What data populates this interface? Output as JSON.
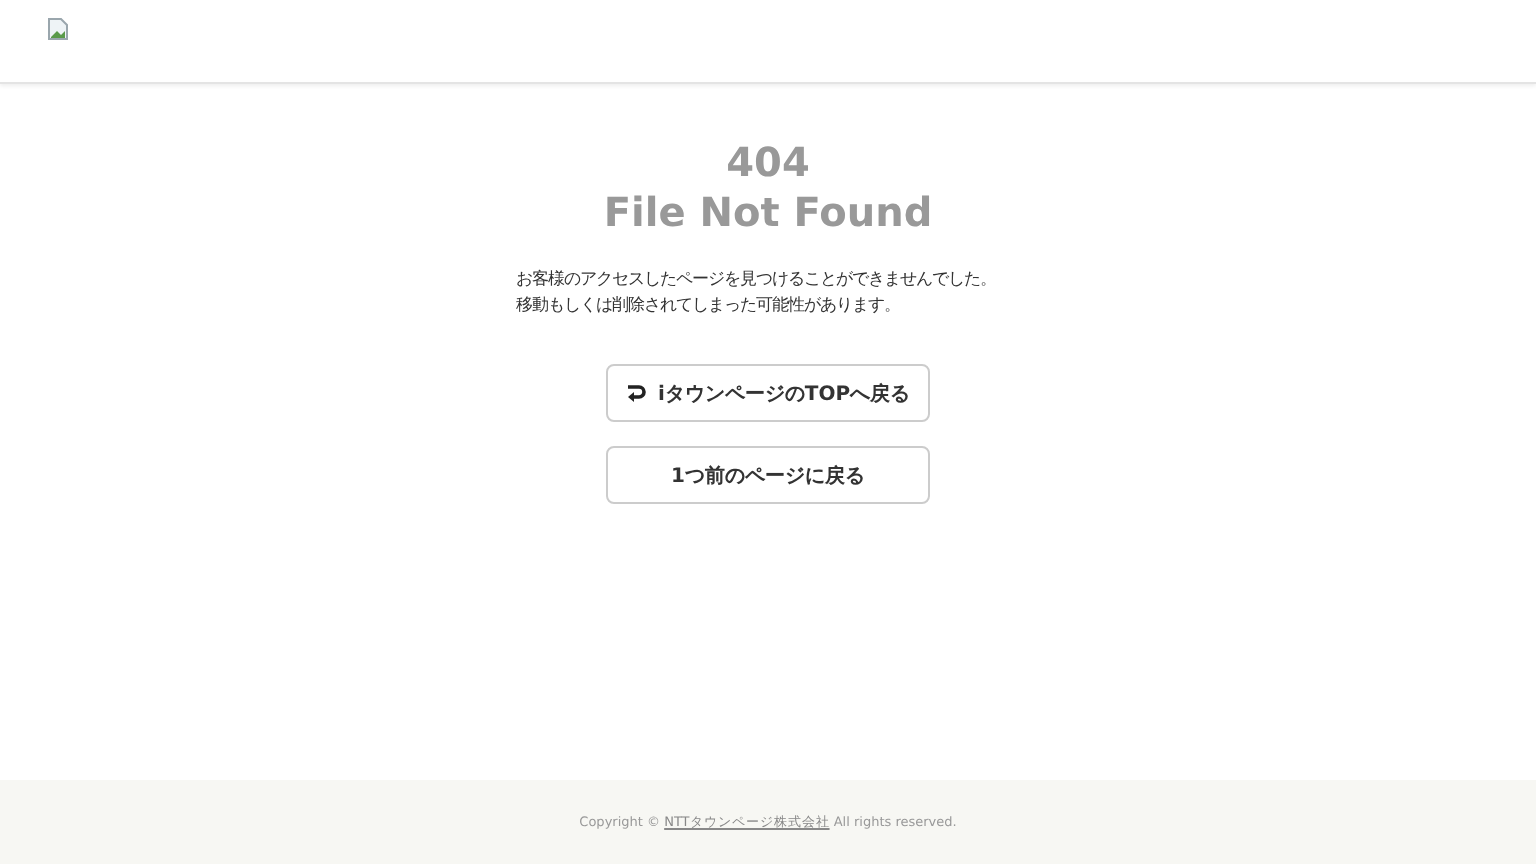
{
  "error": {
    "code": "404",
    "title": "File Not Found"
  },
  "message": [
    "お客様のアクセスしたページを見つけることができませんでした。",
    "移動もしくは削除されてしまった可能性があります。"
  ],
  "buttons": [
    {
      "label": "iタウンページのTOPへ戻る",
      "kind": "home"
    },
    {
      "label": "1つ前のページに戻る",
      "kind": "back"
    }
  ],
  "footer": {
    "prefix": "Copyright ©",
    "link": "NTTタウンページ株式会社",
    "suffix": "All rights reserved."
  }
}
